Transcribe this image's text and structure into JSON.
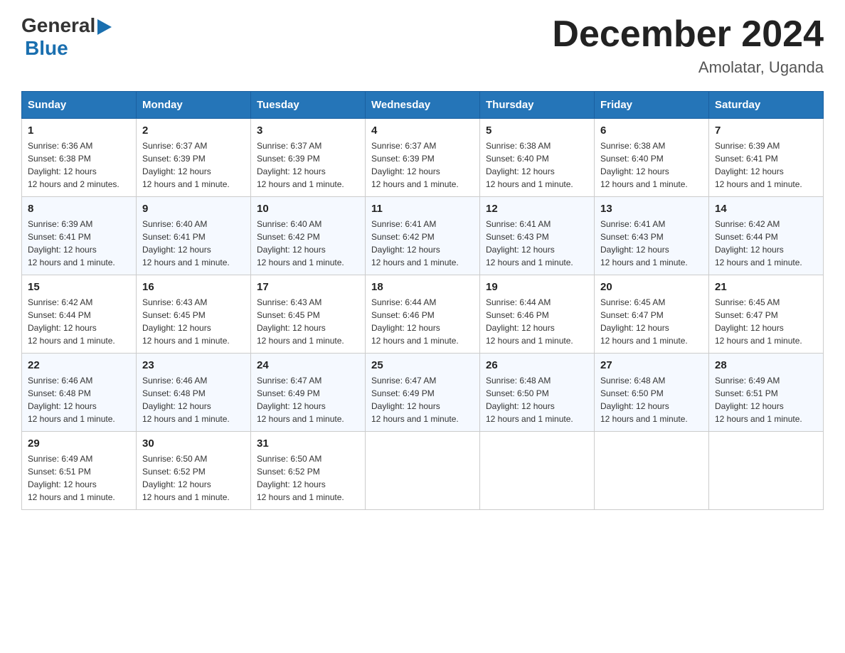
{
  "header": {
    "logo": {
      "general": "General",
      "blue": "Blue"
    },
    "title": "December 2024",
    "location": "Amolatar, Uganda"
  },
  "weekdays": [
    "Sunday",
    "Monday",
    "Tuesday",
    "Wednesday",
    "Thursday",
    "Friday",
    "Saturday"
  ],
  "weeks": [
    [
      {
        "day": "1",
        "sunrise": "6:36 AM",
        "sunset": "6:38 PM",
        "daylight": "12 hours and 2 minutes."
      },
      {
        "day": "2",
        "sunrise": "6:37 AM",
        "sunset": "6:39 PM",
        "daylight": "12 hours and 1 minute."
      },
      {
        "day": "3",
        "sunrise": "6:37 AM",
        "sunset": "6:39 PM",
        "daylight": "12 hours and 1 minute."
      },
      {
        "day": "4",
        "sunrise": "6:37 AM",
        "sunset": "6:39 PM",
        "daylight": "12 hours and 1 minute."
      },
      {
        "day": "5",
        "sunrise": "6:38 AM",
        "sunset": "6:40 PM",
        "daylight": "12 hours and 1 minute."
      },
      {
        "day": "6",
        "sunrise": "6:38 AM",
        "sunset": "6:40 PM",
        "daylight": "12 hours and 1 minute."
      },
      {
        "day": "7",
        "sunrise": "6:39 AM",
        "sunset": "6:41 PM",
        "daylight": "12 hours and 1 minute."
      }
    ],
    [
      {
        "day": "8",
        "sunrise": "6:39 AM",
        "sunset": "6:41 PM",
        "daylight": "12 hours and 1 minute."
      },
      {
        "day": "9",
        "sunrise": "6:40 AM",
        "sunset": "6:41 PM",
        "daylight": "12 hours and 1 minute."
      },
      {
        "day": "10",
        "sunrise": "6:40 AM",
        "sunset": "6:42 PM",
        "daylight": "12 hours and 1 minute."
      },
      {
        "day": "11",
        "sunrise": "6:41 AM",
        "sunset": "6:42 PM",
        "daylight": "12 hours and 1 minute."
      },
      {
        "day": "12",
        "sunrise": "6:41 AM",
        "sunset": "6:43 PM",
        "daylight": "12 hours and 1 minute."
      },
      {
        "day": "13",
        "sunrise": "6:41 AM",
        "sunset": "6:43 PM",
        "daylight": "12 hours and 1 minute."
      },
      {
        "day": "14",
        "sunrise": "6:42 AM",
        "sunset": "6:44 PM",
        "daylight": "12 hours and 1 minute."
      }
    ],
    [
      {
        "day": "15",
        "sunrise": "6:42 AM",
        "sunset": "6:44 PM",
        "daylight": "12 hours and 1 minute."
      },
      {
        "day": "16",
        "sunrise": "6:43 AM",
        "sunset": "6:45 PM",
        "daylight": "12 hours and 1 minute."
      },
      {
        "day": "17",
        "sunrise": "6:43 AM",
        "sunset": "6:45 PM",
        "daylight": "12 hours and 1 minute."
      },
      {
        "day": "18",
        "sunrise": "6:44 AM",
        "sunset": "6:46 PM",
        "daylight": "12 hours and 1 minute."
      },
      {
        "day": "19",
        "sunrise": "6:44 AM",
        "sunset": "6:46 PM",
        "daylight": "12 hours and 1 minute."
      },
      {
        "day": "20",
        "sunrise": "6:45 AM",
        "sunset": "6:47 PM",
        "daylight": "12 hours and 1 minute."
      },
      {
        "day": "21",
        "sunrise": "6:45 AM",
        "sunset": "6:47 PM",
        "daylight": "12 hours and 1 minute."
      }
    ],
    [
      {
        "day": "22",
        "sunrise": "6:46 AM",
        "sunset": "6:48 PM",
        "daylight": "12 hours and 1 minute."
      },
      {
        "day": "23",
        "sunrise": "6:46 AM",
        "sunset": "6:48 PM",
        "daylight": "12 hours and 1 minute."
      },
      {
        "day": "24",
        "sunrise": "6:47 AM",
        "sunset": "6:49 PM",
        "daylight": "12 hours and 1 minute."
      },
      {
        "day": "25",
        "sunrise": "6:47 AM",
        "sunset": "6:49 PM",
        "daylight": "12 hours and 1 minute."
      },
      {
        "day": "26",
        "sunrise": "6:48 AM",
        "sunset": "6:50 PM",
        "daylight": "12 hours and 1 minute."
      },
      {
        "day": "27",
        "sunrise": "6:48 AM",
        "sunset": "6:50 PM",
        "daylight": "12 hours and 1 minute."
      },
      {
        "day": "28",
        "sunrise": "6:49 AM",
        "sunset": "6:51 PM",
        "daylight": "12 hours and 1 minute."
      }
    ],
    [
      {
        "day": "29",
        "sunrise": "6:49 AM",
        "sunset": "6:51 PM",
        "daylight": "12 hours and 1 minute."
      },
      {
        "day": "30",
        "sunrise": "6:50 AM",
        "sunset": "6:52 PM",
        "daylight": "12 hours and 1 minute."
      },
      {
        "day": "31",
        "sunrise": "6:50 AM",
        "sunset": "6:52 PM",
        "daylight": "12 hours and 1 minute."
      },
      null,
      null,
      null,
      null
    ]
  ],
  "labels": {
    "sunrise": "Sunrise:",
    "sunset": "Sunset:",
    "daylight": "Daylight:"
  },
  "accent_color": "#2575b8"
}
